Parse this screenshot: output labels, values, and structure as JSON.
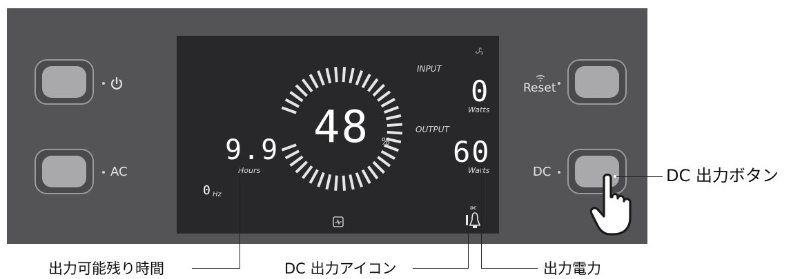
{
  "controls": {
    "power_label": "",
    "ac_label": "AC",
    "reset_label": "Reset",
    "dc_label": "DC"
  },
  "display": {
    "battery_percent": 48,
    "battery_text": "48",
    "percent_sign": "%",
    "input_label": "INPUT",
    "input_value": "0",
    "input_unit": "Watts",
    "output_label": "OUTPUT",
    "output_value": "60",
    "output_unit": "Watts",
    "hours_value": "9.9",
    "hours_unit": "Hours",
    "frequency_value": "0",
    "frequency_unit": "Hz",
    "dc_icon_text": "DC"
  },
  "annotations": {
    "dc_button": "DC 出力ボタン",
    "remaining_time": "出力可能残り時間",
    "dc_output_icon": "DC 出力アイコン",
    "output_power": "出力電力"
  },
  "colors": {
    "panel": "#545457",
    "screen": "#28282b",
    "button": "#a9a9ac"
  }
}
